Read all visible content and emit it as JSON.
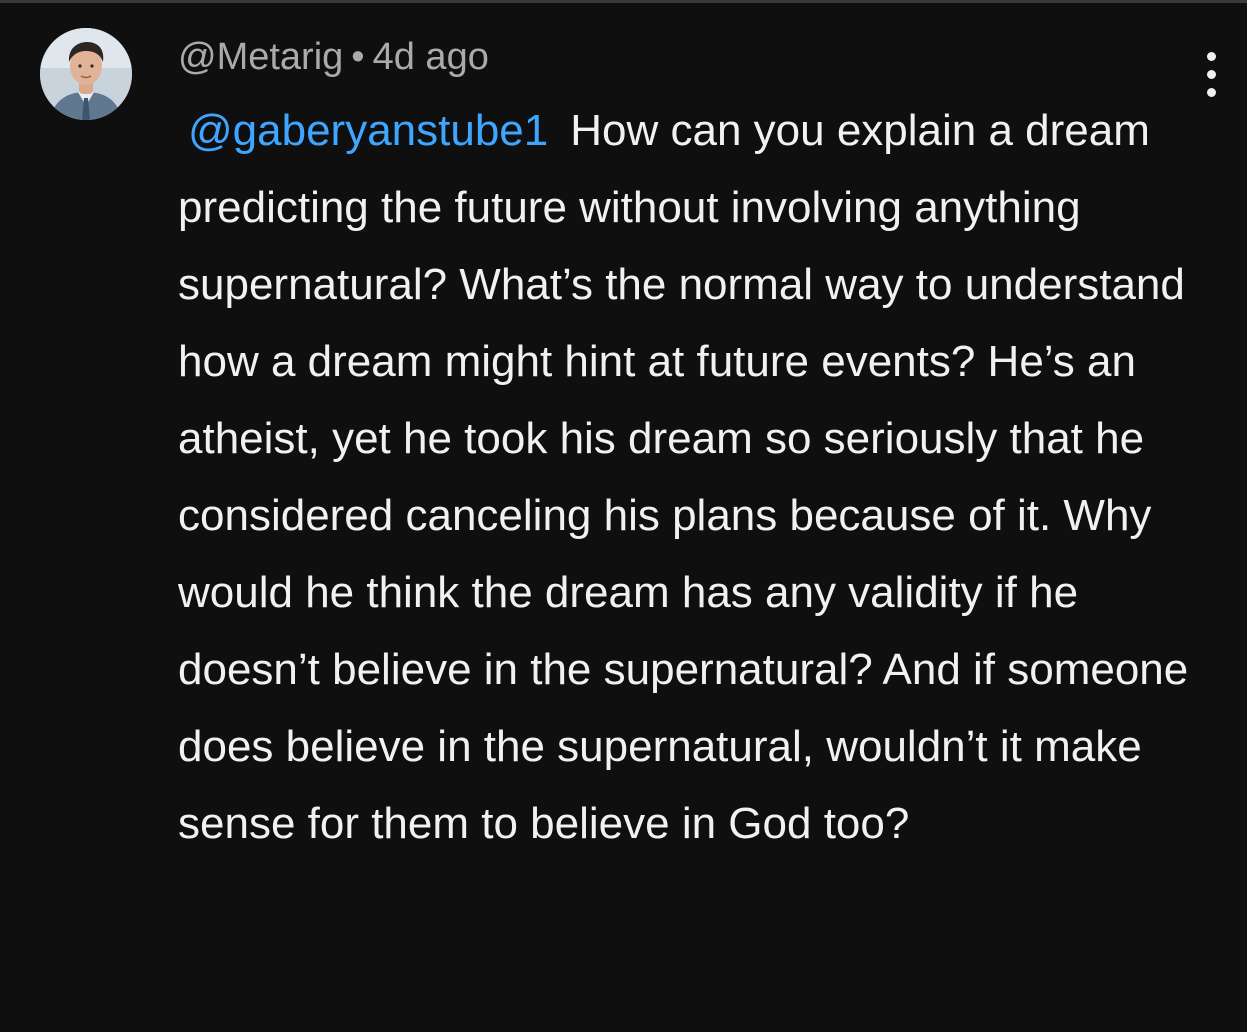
{
  "comment": {
    "handle": "@Metarig",
    "separator": "•",
    "time": "4d ago",
    "mention": "@gaberyanstube1",
    "body": "How can you explain a dream predicting the future without involving anything supernatural? What’s the normal way to understand how a dream might hint at future events? He’s an atheist, yet he took his dream so seriously that he considered canceling his plans because of it. Why would he think the dream has any validity if he doesn’t believe in the supernatural? And if someone does believe in the supernatural, wouldn’t it make sense for them to believe in God too?"
  },
  "icons": {
    "avatar": "avatar-man-portrait",
    "menu": "more-vertical-icon"
  },
  "colors": {
    "background": "#0f0f0f",
    "text": "#f1f1f1",
    "meta": "#aaaaaa",
    "mention": "#3ea6ff"
  }
}
